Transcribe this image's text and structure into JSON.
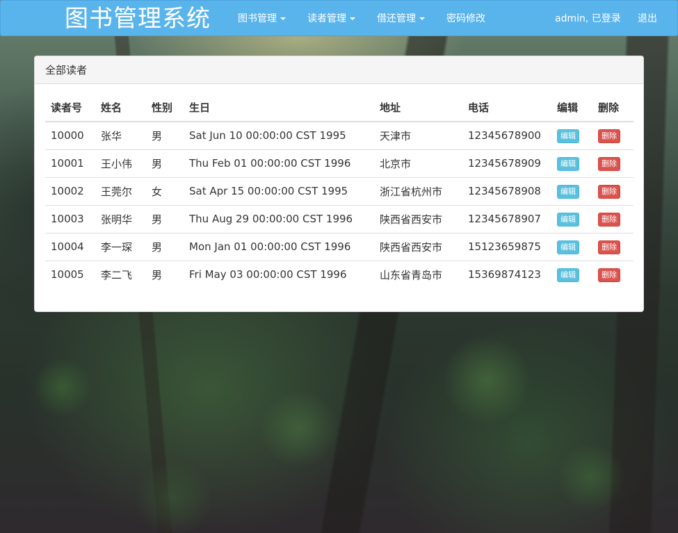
{
  "navbar": {
    "brand": "图书管理系统",
    "menus": [
      {
        "label": "图书管理"
      },
      {
        "label": "读者管理"
      },
      {
        "label": "借还管理"
      }
    ],
    "password_link": "密码修改",
    "user_status": "admin, 已登录",
    "logout": "退出",
    "color": "#5ab4ec"
  },
  "panel": {
    "title": "全部读者"
  },
  "table": {
    "headers": [
      "读者号",
      "姓名",
      "性别",
      "生日",
      "地址",
      "电话",
      "编辑",
      "删除"
    ],
    "rows": [
      {
        "id": "10000",
        "name": "张华",
        "sex": "男",
        "birthday": "Sat Jun 10 00:00:00 CST 1995",
        "address": "天津市",
        "phone": "12345678900"
      },
      {
        "id": "10001",
        "name": "王小伟",
        "sex": "男",
        "birthday": "Thu Feb 01 00:00:00 CST 1996",
        "address": "北京市",
        "phone": "12345678909"
      },
      {
        "id": "10002",
        "name": "王莞尔",
        "sex": "女",
        "birthday": "Sat Apr 15 00:00:00 CST 1995",
        "address": "浙江省杭州市",
        "phone": "12345678908"
      },
      {
        "id": "10003",
        "name": "张明华",
        "sex": "男",
        "birthday": "Thu Aug 29 00:00:00 CST 1996",
        "address": "陕西省西安市",
        "phone": "12345678907"
      },
      {
        "id": "10004",
        "name": "李一琛",
        "sex": "男",
        "birthday": "Mon Jan 01 00:00:00 CST 1996",
        "address": "陕西省西安市",
        "phone": "15123659875"
      },
      {
        "id": "10005",
        "name": "李二飞",
        "sex": "男",
        "birthday": "Fri May 03 00:00:00 CST 1996",
        "address": "山东省青岛市",
        "phone": "15369874123"
      }
    ],
    "edit_label": "编辑",
    "delete_label": "删除",
    "edit_color": "#5bc0de",
    "delete_color": "#d9534f"
  }
}
